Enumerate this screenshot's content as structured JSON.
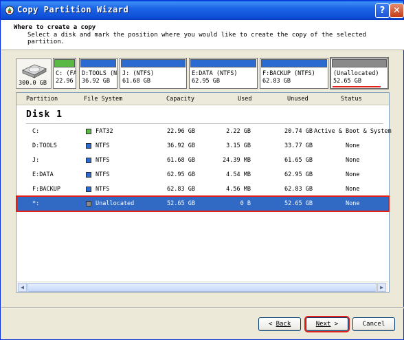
{
  "window": {
    "title": "Copy Partition Wizard",
    "help_label": "?",
    "close_label": "✕"
  },
  "header": {
    "title": "Where to create a copy",
    "subtitle": "Select a disk and mark the position where you would like to create the copy of the selected partition."
  },
  "disk_strip": {
    "disk_capacity": "300.0 GB",
    "partitions": [
      {
        "line1": "C: (FA",
        "line2": "22.96",
        "color": "#5ab945"
      },
      {
        "line1": "D:TOOLS (NT",
        "line2": "36.92 GB",
        "color": "#2a6ad1"
      },
      {
        "line1": "J: (NTFS)",
        "line2": "61.68 GB",
        "color": "#2a6ad1"
      },
      {
        "line1": "E:DATA (NTFS)",
        "line2": "62.95 GB",
        "color": "#2a6ad1"
      },
      {
        "line1": "F:BACKUP (NTFS)",
        "line2": "62.83 GB",
        "color": "#2a6ad1"
      },
      {
        "line1": "(Unallocated)",
        "line2": "52.65 GB",
        "color": "#8a8a8a"
      }
    ]
  },
  "list": {
    "columns": [
      "Partition",
      "File System",
      "Capacity",
      "Used",
      "Unused",
      "Status"
    ],
    "disk_label": "Disk 1",
    "rows": [
      {
        "partition": "C:",
        "fs": "FAT32",
        "fs_color": "#5ab945",
        "capacity": "22.96 GB",
        "used": "2.22 GB",
        "unused": "20.74 GB",
        "status": "Active & Boot & System"
      },
      {
        "partition": "D:TOOLS",
        "fs": "NTFS",
        "fs_color": "#2a6ad1",
        "capacity": "36.92 GB",
        "used": "3.15 GB",
        "unused": "33.77 GB",
        "status": "None"
      },
      {
        "partition": "J:",
        "fs": "NTFS",
        "fs_color": "#2a6ad1",
        "capacity": "61.68 GB",
        "used": "24.39 MB",
        "unused": "61.65 GB",
        "status": "None"
      },
      {
        "partition": "E:DATA",
        "fs": "NTFS",
        "fs_color": "#2a6ad1",
        "capacity": "62.95 GB",
        "used": "4.54 MB",
        "unused": "62.95 GB",
        "status": "None"
      },
      {
        "partition": "F:BACKUP",
        "fs": "NTFS",
        "fs_color": "#2a6ad1",
        "capacity": "62.83 GB",
        "used": "4.56 MB",
        "unused": "62.83 GB",
        "status": "None"
      },
      {
        "partition": "*:",
        "fs": "Unallocated",
        "fs_color": "#8a8a8a",
        "capacity": "52.65 GB",
        "used": "0 B",
        "unused": "52.65 GB",
        "status": "None"
      }
    ]
  },
  "buttons": {
    "back": "Back",
    "next": "Next",
    "cancel": "Cancel"
  }
}
